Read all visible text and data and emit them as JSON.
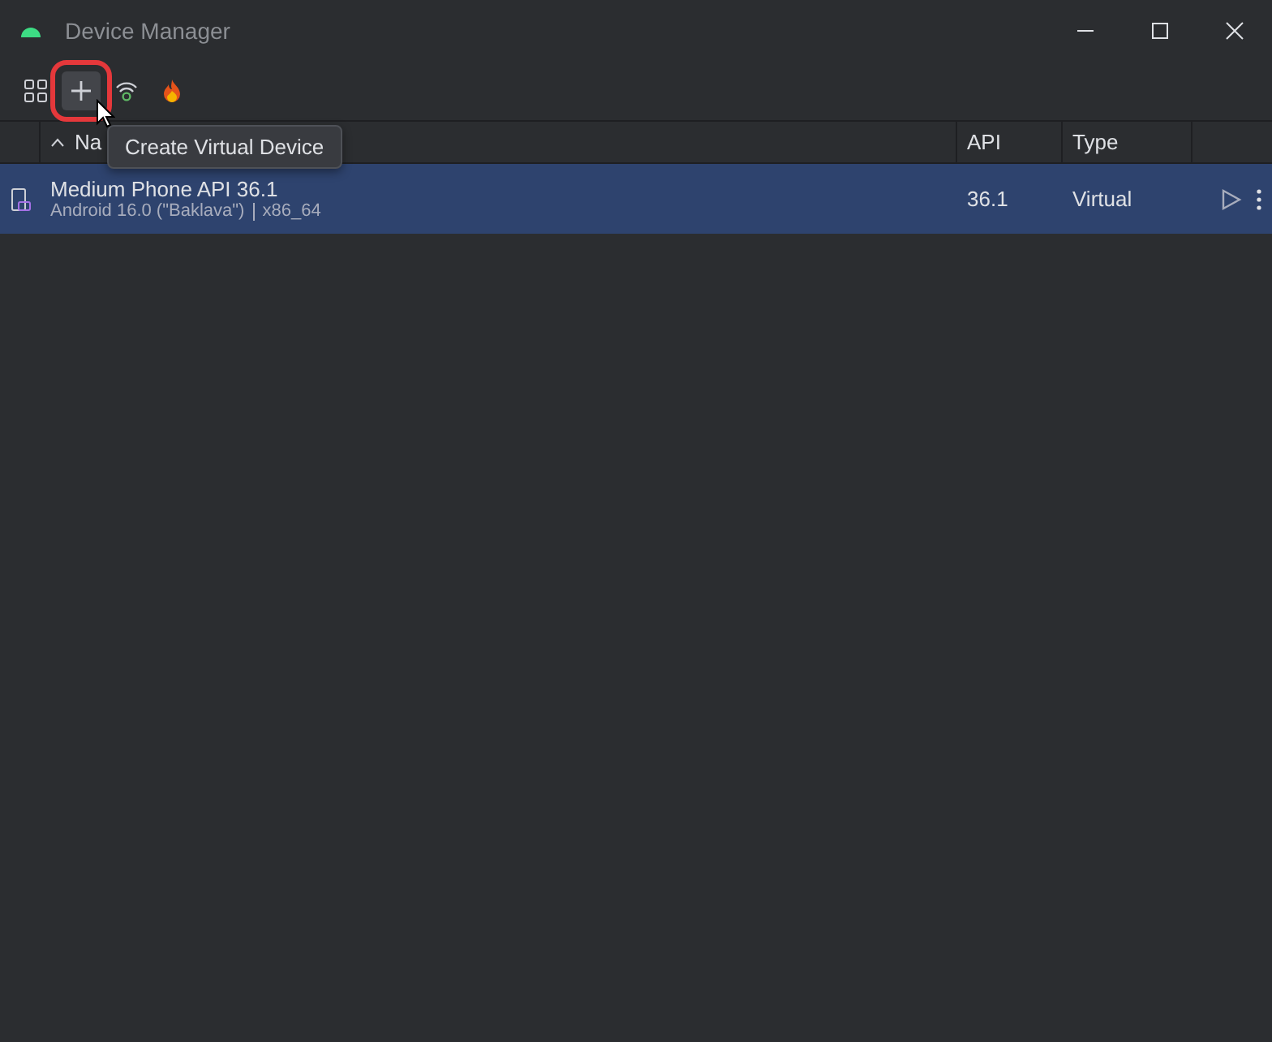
{
  "window": {
    "title": "Device Manager"
  },
  "toolbar": {
    "buttons": [
      {
        "kind": "grid"
      },
      {
        "kind": "add",
        "highlighted": true
      },
      {
        "kind": "wifi"
      },
      {
        "kind": "flame"
      }
    ]
  },
  "tooltip": {
    "text": "Create Virtual Device"
  },
  "table": {
    "columns": [
      {
        "label": "Na",
        "sorted_ascending": true
      },
      {
        "label": "API"
      },
      {
        "label": "Type"
      }
    ],
    "rows": [
      {
        "name": "Medium Phone API 36.1",
        "detail": "Android 16.0 (\"Baklava\")",
        "abi": "x86_64",
        "api": "36.1",
        "type": "Virtual",
        "selected": true
      }
    ]
  }
}
